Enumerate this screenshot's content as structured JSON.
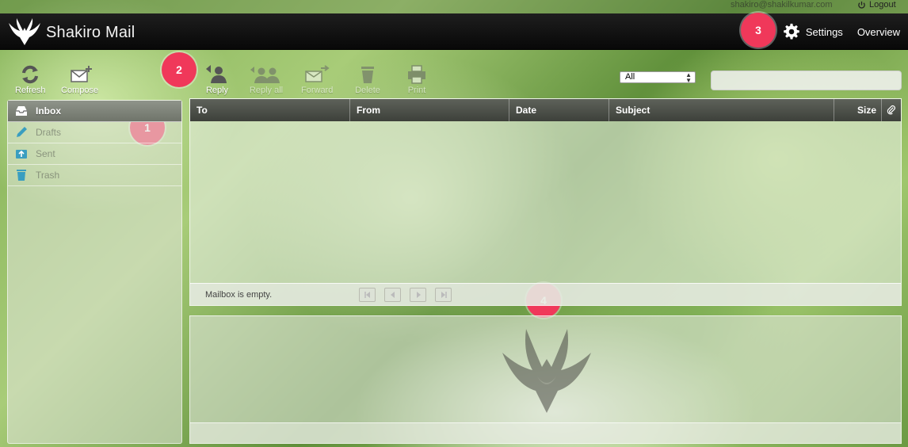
{
  "top_strip": {
    "user": "shakiro@shakilkumar.com",
    "logout_label": "Logout"
  },
  "header": {
    "brand": "Shakiro Mail",
    "settings_label": "Settings",
    "overview_label": "Overview"
  },
  "markers": [
    "1",
    "2",
    "3",
    "4"
  ],
  "toolbar": {
    "refresh_label": "Refresh",
    "compose_label": "Compose",
    "reply_label": "Reply",
    "reply_all_label": "Reply all",
    "forward_label": "Forward",
    "delete_label": "Delete",
    "print_label": "Print"
  },
  "filter": {
    "selected": "All"
  },
  "folders": [
    {
      "label": "Inbox",
      "icon": "inbox-icon"
    },
    {
      "label": "Drafts",
      "icon": "pencil-icon"
    },
    {
      "label": "Sent",
      "icon": "sent-icon"
    },
    {
      "label": "Trash",
      "icon": "trash-icon"
    }
  ],
  "list": {
    "columns": {
      "to": "To",
      "from": "From",
      "date": "Date",
      "subject": "Subject",
      "size": "Size"
    },
    "empty_message": "Mailbox is empty."
  },
  "colors": {
    "header_bg": "#0b0b0b",
    "marker": "#f0385a",
    "active_folder": "#7f847a"
  }
}
